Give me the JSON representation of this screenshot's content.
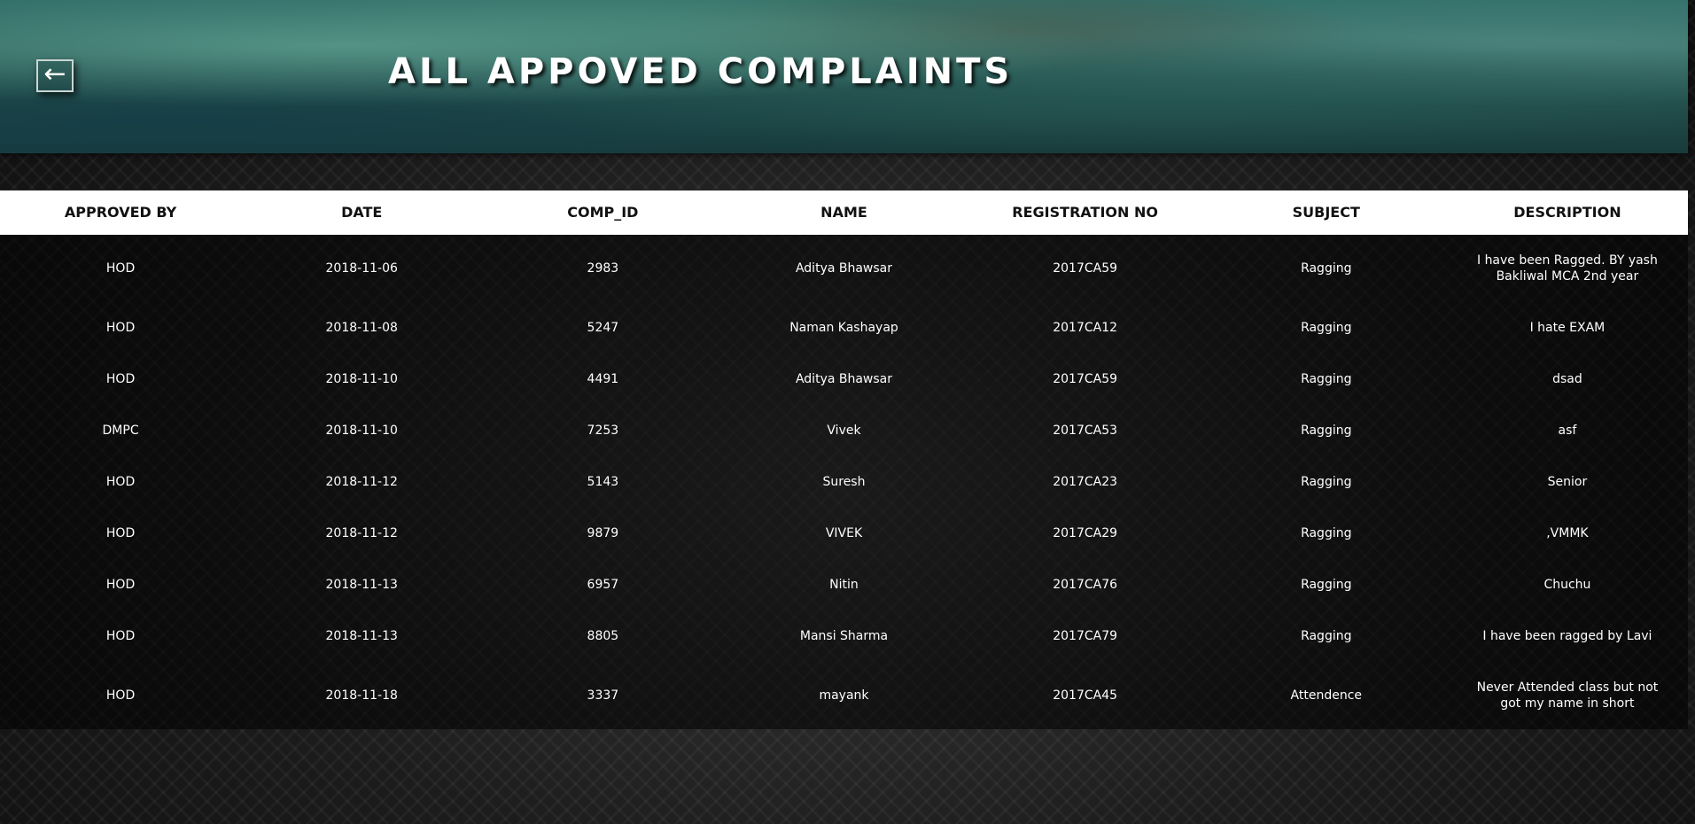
{
  "header": {
    "title": "ALL APPOVED COMPLAINTS",
    "back_icon": "←"
  },
  "table": {
    "columns": [
      "APPROVED BY",
      "DATE",
      "COMP_ID",
      "NAME",
      "REGISTRATION NO",
      "SUBJECT",
      "DESCRIPTION"
    ],
    "rows": [
      [
        "HOD",
        "2018-11-06",
        "2983",
        "Aditya Bhawsar",
        "2017CA59",
        "Ragging",
        "I have been Ragged. BY yash Bakliwal MCA 2nd year"
      ],
      [
        "HOD",
        "2018-11-08",
        "5247",
        "Naman Kashayap",
        "2017CA12",
        "Ragging",
        "I hate EXAM"
      ],
      [
        "HOD",
        "2018-11-10",
        "4491",
        "Aditya Bhawsar",
        "2017CA59",
        "Ragging",
        "dsad"
      ],
      [
        "DMPC",
        "2018-11-10",
        "7253",
        "Vivek",
        "2017CA53",
        "Ragging",
        "asf"
      ],
      [
        "HOD",
        "2018-11-12",
        "5143",
        "Suresh",
        "2017CA23",
        "Ragging",
        "Senior"
      ],
      [
        "HOD",
        "2018-11-12",
        "9879",
        "VIVEK",
        "2017CA29",
        "Ragging",
        ",VMMK"
      ],
      [
        "HOD",
        "2018-11-13",
        "6957",
        "Nitin",
        "2017CA76",
        "Ragging",
        "Chuchu"
      ],
      [
        "HOD",
        "2018-11-13",
        "8805",
        "Mansi Sharma",
        "2017CA79",
        "Ragging",
        "I have been ragged by Lavi"
      ],
      [
        "HOD",
        "2018-11-18",
        "3337",
        "mayank",
        "2017CA45",
        "Attendence",
        "Never Attended class but not got my name in short"
      ]
    ]
  }
}
